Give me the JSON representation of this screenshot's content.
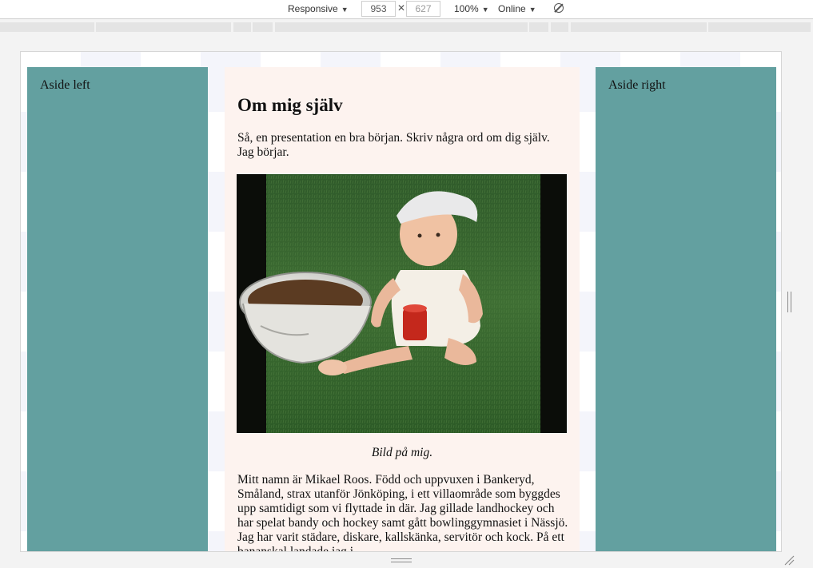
{
  "toolbar": {
    "device": "Responsive",
    "width_value": "953",
    "height_placeholder": "627",
    "times": "✕",
    "zoom": "100%",
    "network": "Online",
    "rotate_icon": "rotate-icon"
  },
  "page": {
    "aside_left": "Aside left",
    "aside_right": "Aside right",
    "heading": "Om mig själv",
    "intro": "Så, en presentation en bra början. Skriv några ord om dig själv. Jag börjar.",
    "photo_alt": "Bild på mig",
    "caption": "Bild på mig.",
    "bio": "Mitt namn är Mikael Roos. Född och uppvuxen i Bankeryd, Småland, strax utanför Jönköping, i ett villaområde som byggdes upp samtidigt som vi flyttade in där. Jag gillade landhockey och har spelat bandy och hockey samt gått bowlinggymnasiet i Nässjö. Jag har varit städare, diskare, kallskänka, servitör och kock. På ett bananskal landade jag i"
  },
  "colors": {
    "aside": "#63a0a0",
    "main_bg": "#fdf3ef",
    "toolbar_bg": "#ffffff"
  }
}
